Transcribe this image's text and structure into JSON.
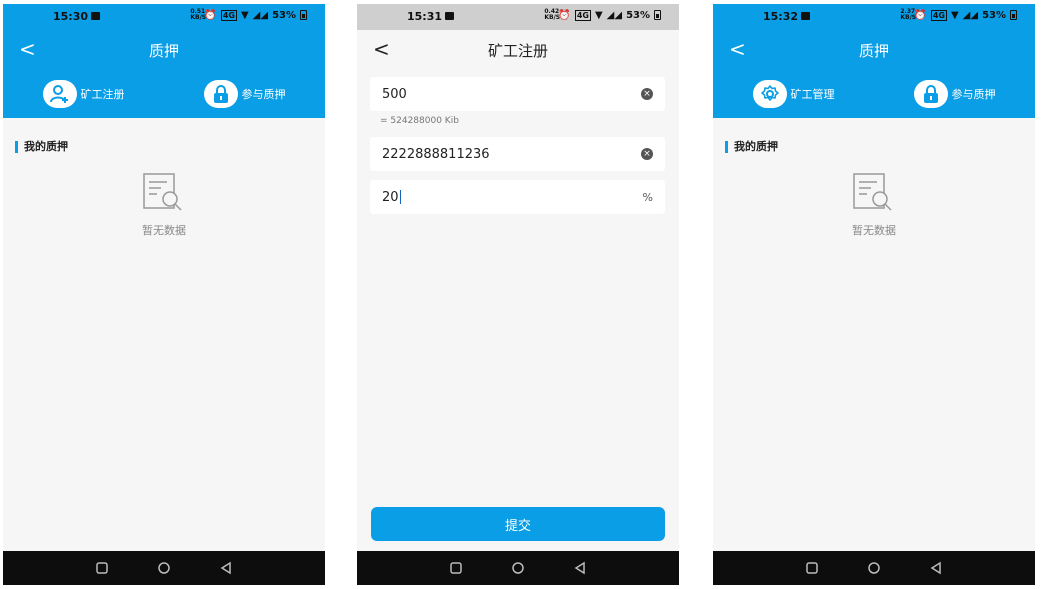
{
  "screens": [
    {
      "status": {
        "time": "15:30",
        "net_top": "0.51",
        "net_bottom": "KB/S",
        "battery": "53%"
      },
      "title": "质押",
      "actions": [
        {
          "label": "矿工注册",
          "icon": "user-add-icon"
        },
        {
          "label": "参与质押",
          "icon": "lock-icon"
        }
      ],
      "section_title": "我的质押",
      "empty_text": "暂无数据"
    },
    {
      "status": {
        "time": "15:31",
        "net_top": "0.42",
        "net_bottom": "KB/S",
        "battery": "53%"
      },
      "title": "矿工注册",
      "fields": [
        {
          "value": "500",
          "hint": "= 524288000 Kib"
        },
        {
          "value": "2222888811236"
        },
        {
          "value": "20",
          "suffix": "%"
        }
      ],
      "submit_label": "提交"
    },
    {
      "status": {
        "time": "15:32",
        "net_top": "2.37",
        "net_bottom": "KB/S",
        "battery": "53%"
      },
      "title": "质押",
      "actions": [
        {
          "label": "矿工管理",
          "icon": "gear-icon"
        },
        {
          "label": "参与质押",
          "icon": "lock-icon"
        }
      ],
      "section_title": "我的质押",
      "empty_text": "暂无数据"
    }
  ],
  "colors": {
    "accent": "#0a9ee6",
    "background": "#f6f6f6",
    "navbar": "#0d0d0d"
  }
}
